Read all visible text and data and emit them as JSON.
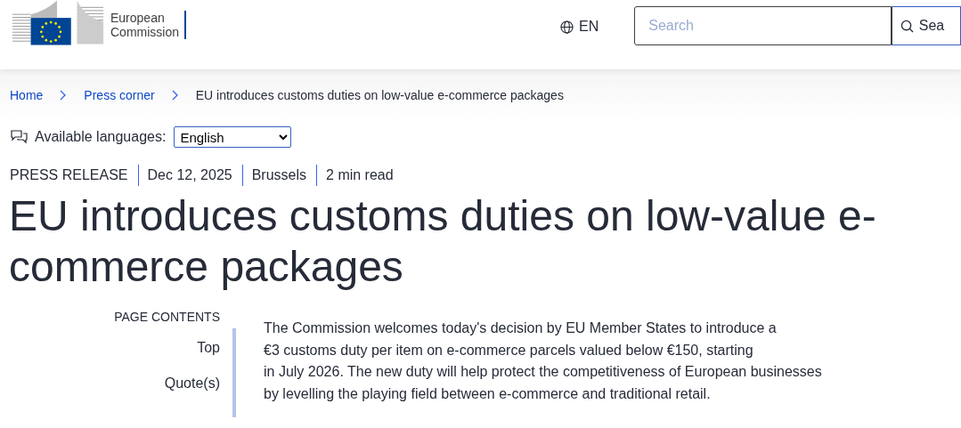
{
  "header": {
    "logo_text": [
      "European",
      "Commission"
    ],
    "language": "EN",
    "search": {
      "placeholder": "Search"
    },
    "search_button": "Sea"
  },
  "breadcrumb": [
    {
      "label": "Home",
      "link": true
    },
    {
      "label": "Press corner",
      "link": true
    },
    {
      "label": "EU introduces customs duties on low-value e-commerce packages",
      "link": false
    }
  ],
  "languages": {
    "label": "Available languages:",
    "value": "English"
  },
  "meta": [
    "PRESS RELEASE",
    "Dec 12, 2025",
    "Brussels",
    "2 min read"
  ],
  "title": [
    "EU introduces customs duties on low-value e-",
    "commerce packages"
  ],
  "page_contents": {
    "heading": "PAGE CONTENTS",
    "items": [
      "Top",
      "Quote(s)"
    ]
  },
  "body": [
    "The Commission welcomes today's decision by EU Member States to introduce a",
    "€3 customs duty per item on e-commerce parcels valued below €150, starting",
    "in July 2026. The new duty will help protect the competitiveness of European businesses",
    "by levelling the playing field between e-commerce and traditional retail."
  ]
}
